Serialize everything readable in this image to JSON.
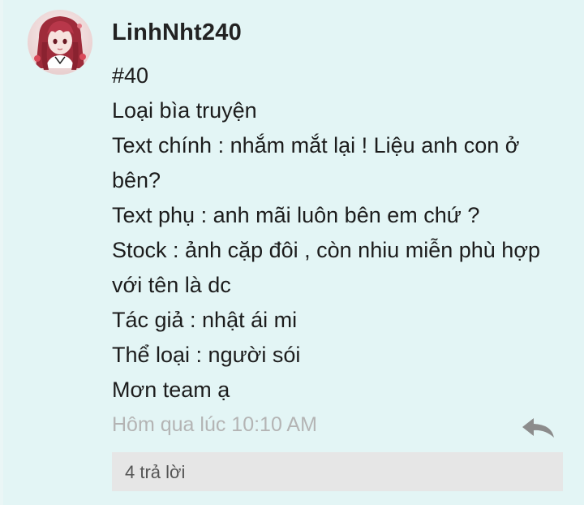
{
  "post": {
    "username": "LinhNht240",
    "avatar_icon": "user-avatar",
    "body_lines": [
      "#40",
      "Loại bìa truyện",
      "Text chính : nhắm mắt lại ! Liệu anh con ở",
      "bên?",
      "Text phụ : anh mãi luôn bên em chứ ?",
      "Stock : ảnh cặp đôi , còn nhiu miễn phù hợp",
      "với tên là dc",
      "Tác giả : nhật ái mi",
      "Thể loại : người sói",
      "Mơn team ạ"
    ],
    "timestamp": "Hôm qua lúc 10:10 AM",
    "reply_icon": "reply-arrow-icon",
    "replies_label": "4 trả lời"
  },
  "colors": {
    "background": "#e3f5f5",
    "timestamp": "#b4b4b4",
    "replies_box": "#e6e6e6",
    "reply_icon": "#8c8c8c"
  }
}
